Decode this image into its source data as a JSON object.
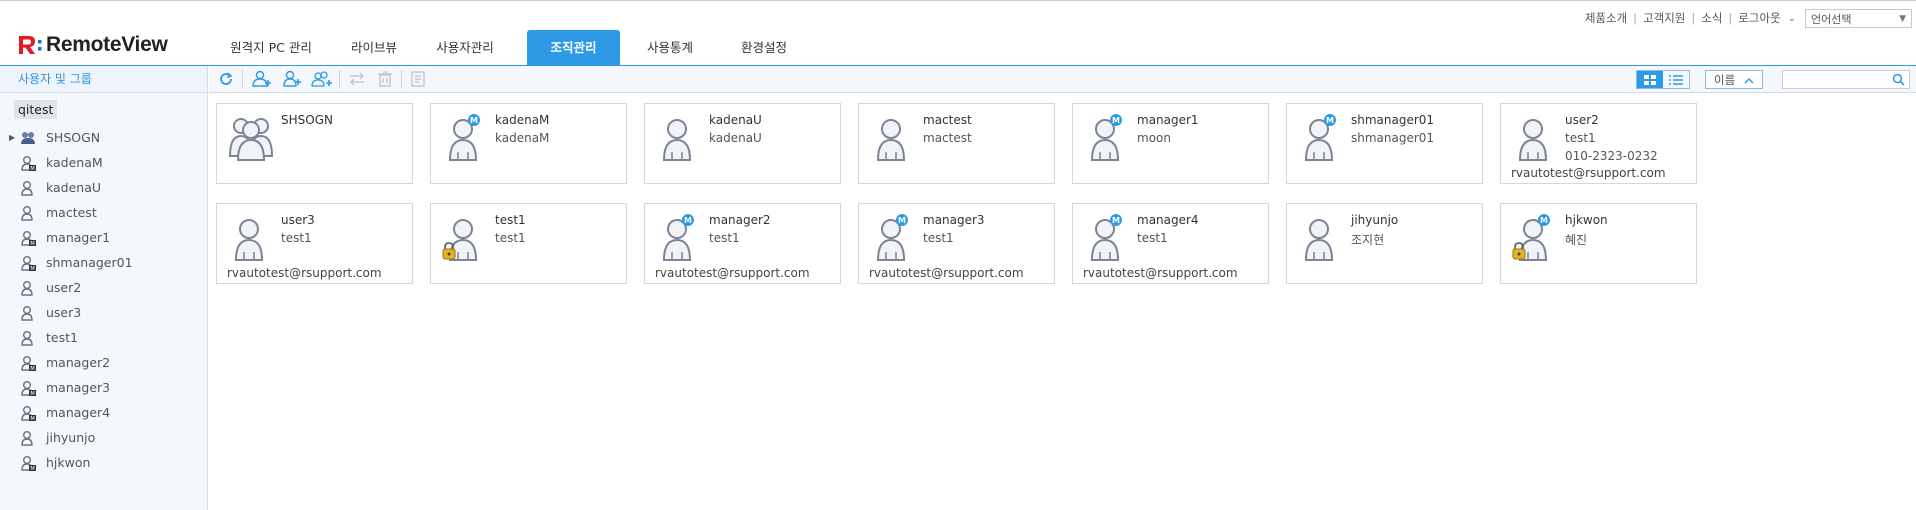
{
  "app": {
    "logo_text": "RemoteView",
    "brand_color": "#e21b23",
    "accent_color": "#2e9ae6"
  },
  "nav": {
    "tabs": [
      {
        "label": "원격지 PC 관리",
        "active": false
      },
      {
        "label": "라이브뷰",
        "active": false
      },
      {
        "label": "사용자관리",
        "active": false
      },
      {
        "label": "조직관리",
        "active": true
      },
      {
        "label": "사용통계",
        "active": false
      },
      {
        "label": "환경설정",
        "active": false
      }
    ]
  },
  "toplinks": {
    "items": [
      "제품소개",
      "고객지원",
      "소식",
      "로그아웃"
    ],
    "lang_select": "언어선택"
  },
  "sidebar": {
    "title": "사용자 및 그룹",
    "root": "qitest",
    "items": [
      {
        "label": "SHSOGN",
        "type": "group",
        "expandable": true
      },
      {
        "label": "kadenaM",
        "type": "manager"
      },
      {
        "label": "kadenaU",
        "type": "user"
      },
      {
        "label": "mactest",
        "type": "user"
      },
      {
        "label": "manager1",
        "type": "manager"
      },
      {
        "label": "shmanager01",
        "type": "manager"
      },
      {
        "label": "user2",
        "type": "user"
      },
      {
        "label": "user3",
        "type": "user"
      },
      {
        "label": "test1",
        "type": "user"
      },
      {
        "label": "manager2",
        "type": "manager"
      },
      {
        "label": "manager3",
        "type": "manager"
      },
      {
        "label": "manager4",
        "type": "manager"
      },
      {
        "label": "jihyunjo",
        "type": "user"
      },
      {
        "label": "hjkwon",
        "type": "manager"
      }
    ]
  },
  "toolbar": {
    "buttons": [
      "refresh-icon",
      "add-group-icon",
      "add-user-icon",
      "add-sub-group-icon",
      "move-icon",
      "delete-icon",
      "memo-icon"
    ],
    "sort_label": "이름",
    "search_placeholder": ""
  },
  "cards": [
    {
      "name": "SHSOGN",
      "sub": "",
      "type": "group"
    },
    {
      "name": "kadenaM",
      "sub": "kadenaM",
      "type": "manager"
    },
    {
      "name": "kadenaU",
      "sub": "kadenaU",
      "type": "user"
    },
    {
      "name": "mactest",
      "sub": "mactest",
      "type": "user"
    },
    {
      "name": "manager1",
      "sub": "moon",
      "type": "manager"
    },
    {
      "name": "shmanager01",
      "sub": "shmanager01",
      "type": "manager"
    },
    {
      "name": "user2",
      "sub": "test1",
      "phone": "010-2323-0232",
      "email": "rvautotest@rsupport.com",
      "type": "user"
    },
    {
      "name": "user3",
      "sub": "test1",
      "email": "rvautotest@rsupport.com",
      "type": "user"
    },
    {
      "name": "test1",
      "sub": "test1",
      "type": "user",
      "locked": true
    },
    {
      "name": "manager2",
      "sub": "test1",
      "email": "rvautotest@rsupport.com",
      "type": "manager"
    },
    {
      "name": "manager3",
      "sub": "test1",
      "email": "rvautotest@rsupport.com",
      "type": "manager"
    },
    {
      "name": "manager4",
      "sub": "test1",
      "email": "rvautotest@rsupport.com",
      "type": "manager"
    },
    {
      "name": "jihyunjo",
      "sub": "조지현",
      "type": "user"
    },
    {
      "name": "hjkwon",
      "sub": "혜진",
      "type": "manager",
      "locked": true
    }
  ]
}
